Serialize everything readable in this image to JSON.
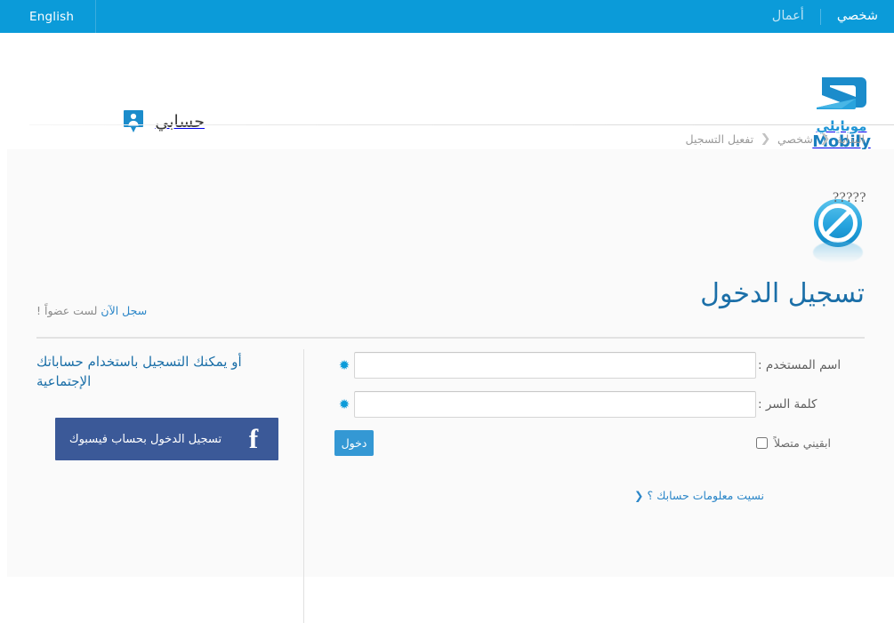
{
  "topbar": {
    "language_label": "English",
    "tabs": [
      {
        "label": "شخصي",
        "state": "active"
      },
      {
        "label": "أعمال",
        "state": "inactive"
      }
    ]
  },
  "header": {
    "account_label": "حسابي",
    "account_icon": "user-badge-icon",
    "logo": {
      "icon": "mobily-logo-icon",
      "arabic": "موبايلي",
      "english": "Mobily"
    }
  },
  "breadcrumb": {
    "items": [
      {
        "label": "البداية"
      },
      {
        "label": "شخصي"
      },
      {
        "label": "تفعيل التسجيل"
      }
    ],
    "separator": "❮"
  },
  "status_glyph": {
    "icon": "no-entry-icon",
    "text": "?????"
  },
  "main": {
    "title": "تسجيل الدخول",
    "signup_prompt": "لست عضواً !",
    "signup_link": "سجل الآن",
    "form": {
      "username": {
        "label": "اسم المستخدم :",
        "value": "",
        "placeholder": "",
        "required_marker": "✹"
      },
      "password": {
        "label": "كلمة السر :",
        "value": "",
        "placeholder": "",
        "required_marker": "✹"
      },
      "remember_label": "ابقيني متصلاً",
      "remember_checked": false,
      "submit_label": "دخول",
      "forgot_link": "نسيت معلومات حسابك ؟ ❮"
    },
    "social": {
      "heading_line1": "أو يمكنك التسجيل باستخدام حساباتك",
      "heading_line2": "الإجتماعية",
      "facebook_label": "تسجيل الدخول بحساب فيسبوك",
      "facebook_icon": "facebook-f-icon",
      "facebook_glyph": "f"
    }
  },
  "colors": {
    "topbar_blue": "#0b9bd9",
    "brand_blue": "#2196d6",
    "title_blue": "#1b6fa8",
    "link_blue": "#2b86c8",
    "button_blue": "#3498d4",
    "facebook_blue": "#3b5998",
    "content_bg": "#fafafa"
  }
}
